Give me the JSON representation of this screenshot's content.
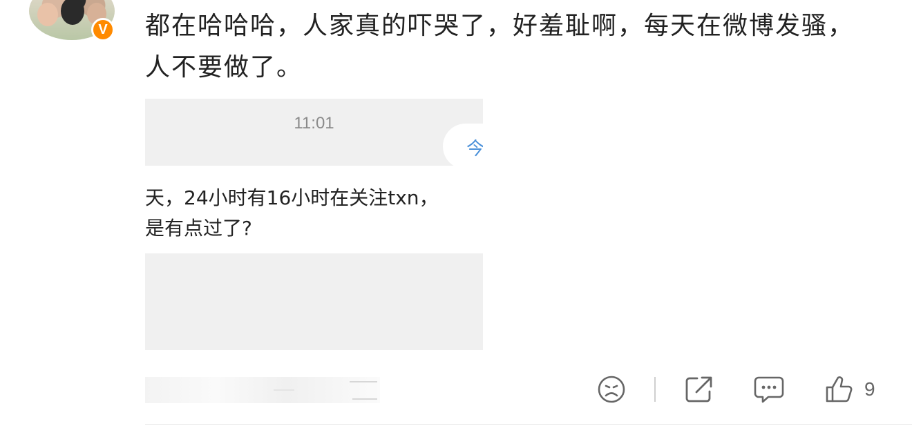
{
  "post": {
    "text": "都在哈哈哈，人家真的吓哭了，好羞耻啊，每天在微博发骚，人不要做了。",
    "verified_badge": "V"
  },
  "screenshot": {
    "time": "11:01",
    "bubble_text": "今",
    "message_line1": "天，24小时有16小时在关注txn，",
    "message_line2": "是有点过了?"
  },
  "actions": {
    "like_count": "9",
    "icons": [
      "sad-face-icon",
      "share-icon",
      "comment-icon",
      "thumbs-up-icon"
    ]
  },
  "colors": {
    "badge": "#ff8a00",
    "bubble_text": "#4a90d9",
    "icon": "#666666"
  }
}
